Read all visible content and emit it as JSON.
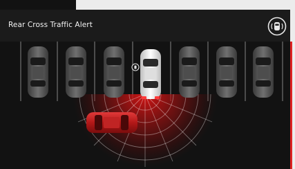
{
  "header": {
    "title": "Rear Cross Traffic Alert",
    "icon": "rear-sensor-car-icon"
  },
  "colors": {
    "background": "#121212",
    "alert_red": "#d32020",
    "own_vehicle": "#f0f0f0",
    "parked_vehicle": "#555555",
    "crossing_vehicle": "#c62828"
  },
  "scene": {
    "parked_vehicles": 6,
    "own_vehicle": "reversing from parking bay",
    "crossing_vehicle_direction": "right-to-left",
    "alert_active": true,
    "sensor_marker_icon": "sensor-marker-icon"
  }
}
